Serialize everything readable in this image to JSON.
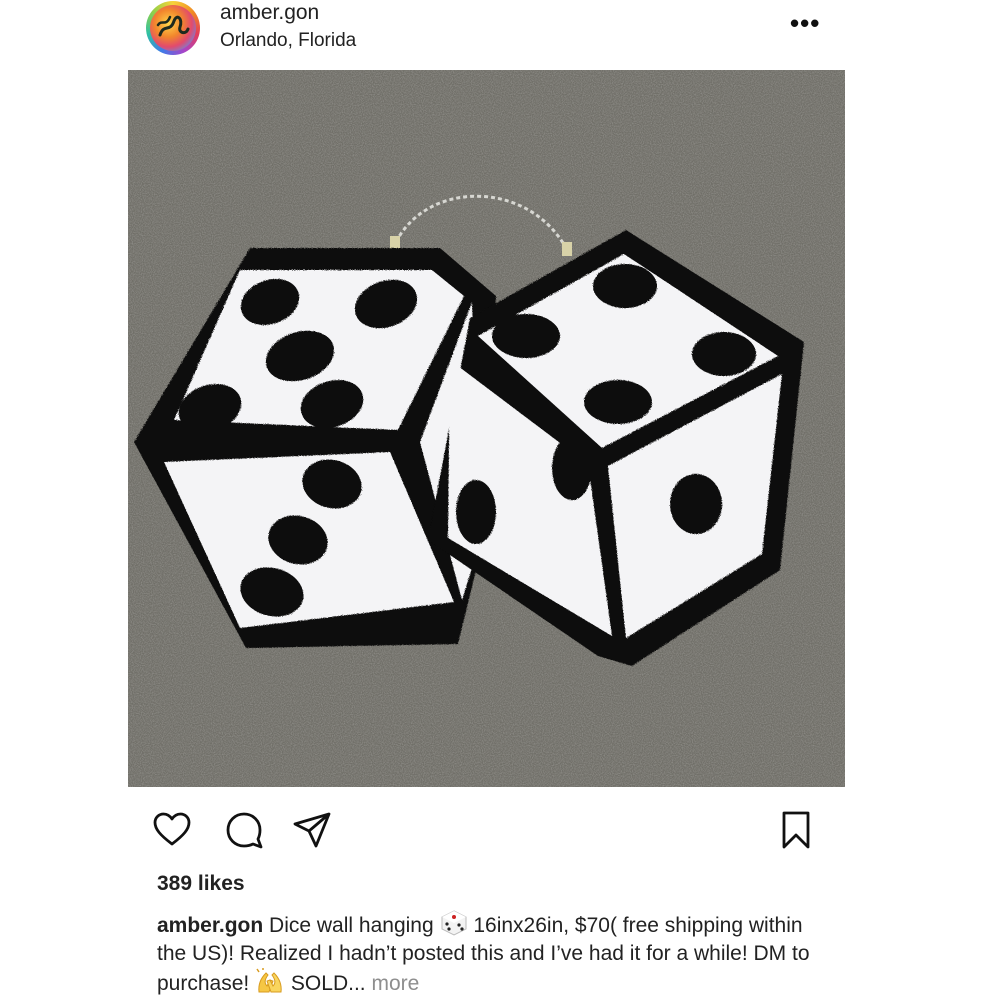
{
  "post": {
    "username": "amber.gon",
    "location": "Orlando, Florida",
    "more_glyph": "•••",
    "likes": "389 likes",
    "caption": {
      "username": "amber.gon",
      "part1": "Dice wall hanging",
      "part2": "16inx26in, $70( free shipping within the US)! Realized I hadn’t posted this and I’ve had it for a while! DM to purchase!",
      "part3": "SOLD...",
      "more": "more"
    }
  },
  "icons": {
    "like": "heart-icon",
    "comment": "comment-bubble-icon",
    "share": "paper-plane-icon",
    "save": "bookmark-icon",
    "dice_emoji": "game-die-emoji",
    "hands_emoji": "raised-hands-emoji"
  },
  "colors": {
    "text": "#222222",
    "muted": "#8e8e8e",
    "asphalt": "#6e6d66",
    "rug_black": "#0b0b0b",
    "rug_white": "#f4f4f6"
  }
}
